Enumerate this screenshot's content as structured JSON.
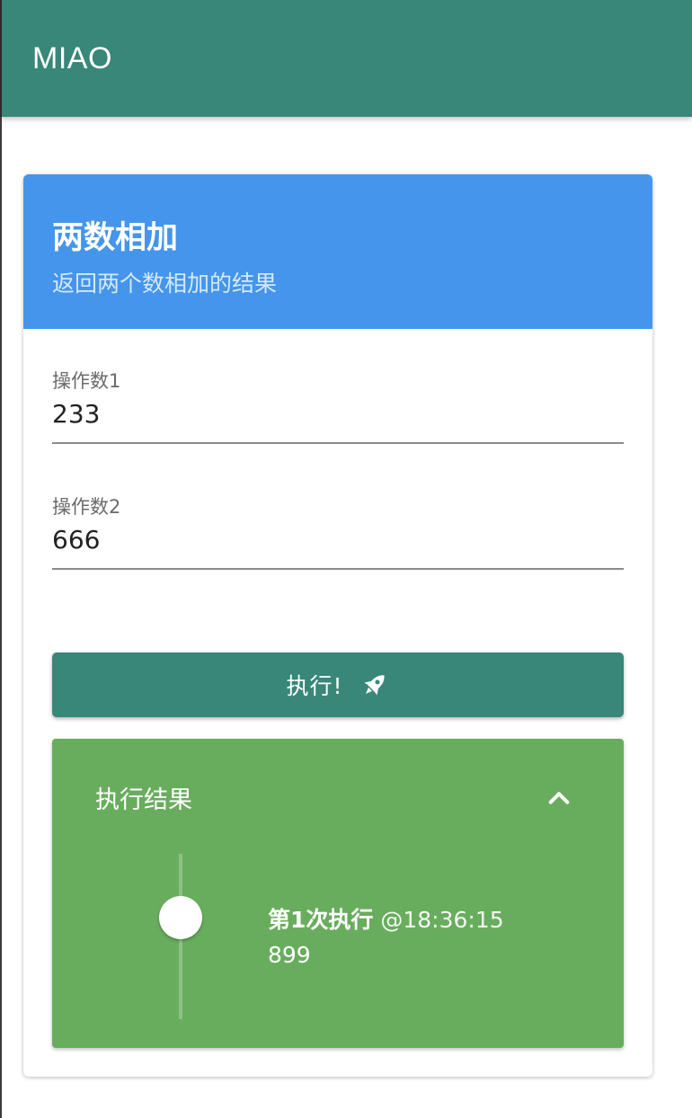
{
  "app": {
    "title": "MIAO"
  },
  "card": {
    "title": "两数相加",
    "subtitle": "返回两个数相加的结果",
    "header_color": "#4495eb"
  },
  "fields": [
    {
      "label": "操作数1",
      "value": "233"
    },
    {
      "label": "操作数2",
      "value": "666"
    }
  ],
  "action": {
    "label": "执行!",
    "icon": "rocket-icon",
    "color": "#388778"
  },
  "result": {
    "title": "执行结果",
    "toggle_icon": "chevron-up-icon",
    "panel_color": "#68ad5d",
    "entries": [
      {
        "title": "第1次执行",
        "time": "@18:36:15",
        "value": "899"
      }
    ]
  }
}
